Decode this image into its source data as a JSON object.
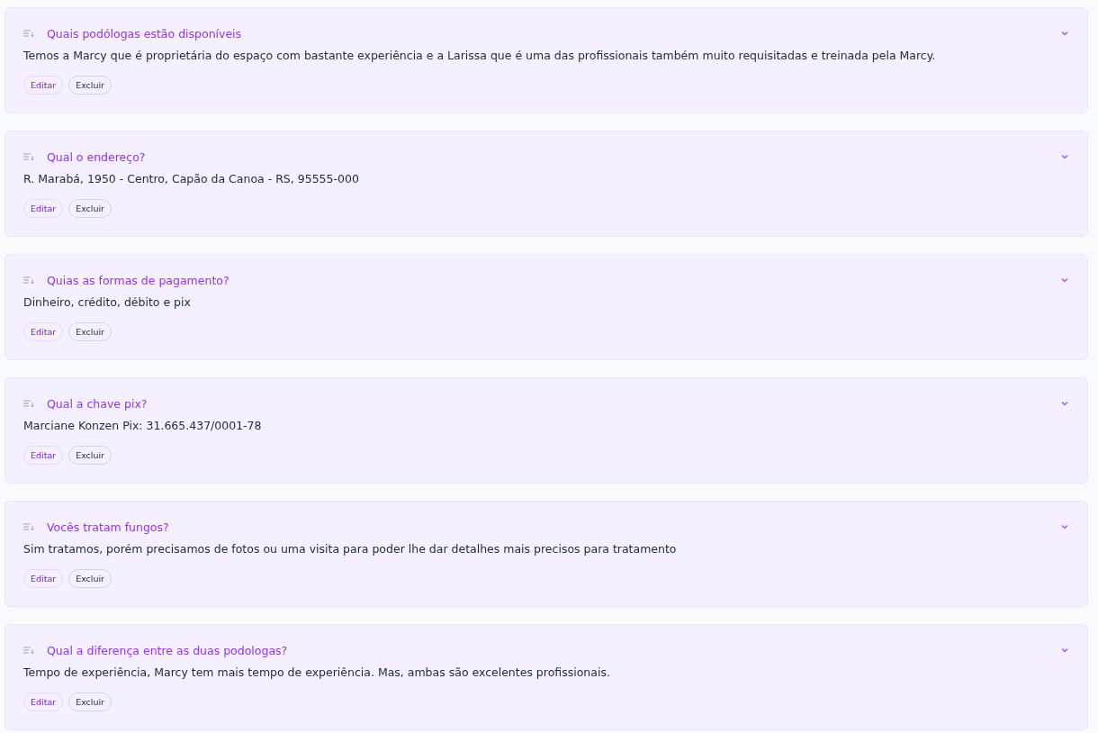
{
  "faqs": [
    {
      "question": "Quais podólogas estão disponíveis",
      "answer": "Temos a Marcy que é proprietária do espaço com bastante experiência e a Larissa que é uma das profissionais também muito requisitadas e treinada pela Marcy.",
      "expanded": true,
      "edit": "Editar",
      "delete": "Excluir"
    },
    {
      "question": "Qual o endereço?",
      "answer": "R. Marabá, 1950 - Centro, Capão da Canoa - RS, 95555-000",
      "expanded": true,
      "edit": "Editar",
      "delete": "Excluir"
    },
    {
      "question": "Quias as formas de pagamento?",
      "answer": "Dinheiro, crédito, débito e pix",
      "expanded": true,
      "edit": "Editar",
      "delete": "Excluir"
    },
    {
      "question": "Qual a chave pix?",
      "answer": "Marciane Konzen Pix: 31.665.437/0001-78",
      "expanded": true,
      "edit": "Editar",
      "delete": "Excluir"
    },
    {
      "question": "Vocês tratam fungos?",
      "answer": "Sim tratamos, porém precisamos de fotos ou uma visita para poder lhe dar detalhes mais precisos para tratamento",
      "expanded": true,
      "edit": "Editar",
      "delete": "Excluir"
    },
    {
      "question": "Qual a diferença entre as duas podologas?",
      "answer": "Tempo de experiência, Marcy tem mais tempo de experiência. Mas, ambas são excelentes profissionais.",
      "expanded": true,
      "edit": "Editar",
      "delete": "Excluir"
    }
  ]
}
